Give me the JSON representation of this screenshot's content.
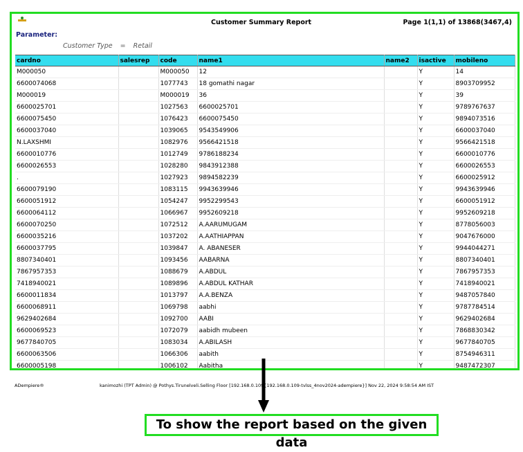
{
  "report": {
    "title": "Customer Summary Report",
    "page_info": "Page 1(1,1) of 13868(3467,4)",
    "parameter_label": "Parameter:",
    "param_name": "Customer Type",
    "param_op": "=",
    "param_value": "Retail"
  },
  "table": {
    "columns": [
      "cardno",
      "salesrep",
      "code",
      "name1",
      "name2",
      "isactive",
      "mobileno"
    ],
    "rows": [
      [
        "M000050",
        "",
        "M000050",
        "12",
        "",
        "Y",
        "14"
      ],
      [
        "6600074068",
        "",
        "1077743",
        "18 gomathi nagar",
        "",
        "Y",
        "8903709952"
      ],
      [
        "M000019",
        "",
        "M000019",
        "36",
        "",
        "Y",
        "39"
      ],
      [
        "6600025701",
        "",
        "1027563",
        "6600025701",
        "",
        "Y",
        "9789767637"
      ],
      [
        "6600075450",
        "",
        "1076423",
        "6600075450",
        "",
        "Y",
        "9894073516"
      ],
      [
        "6600037040",
        "",
        "1039065",
        "9543549906",
        "",
        "Y",
        "6600037040"
      ],
      [
        "N.LAXSHMI",
        "",
        "1082976",
        "9566421518",
        "",
        "Y",
        "9566421518"
      ],
      [
        "6600010776",
        "",
        "1012749",
        "9786188234",
        "",
        "Y",
        "6600010776"
      ],
      [
        "6600026553",
        "",
        "1028280",
        "9843912388",
        "",
        "Y",
        "6600026553"
      ],
      [
        ".",
        "",
        "1027923",
        "9894582239",
        "",
        "Y",
        "6600025912"
      ],
      [
        "6600079190",
        "",
        "1083115",
        "9943639946",
        "",
        "Y",
        "9943639946"
      ],
      [
        "6600051912",
        "",
        "1054247",
        "9952299543",
        "",
        "Y",
        "6600051912"
      ],
      [
        "6600064112",
        "",
        "1066967",
        "9952609218",
        "",
        "Y",
        "9952609218"
      ],
      [
        "6600070250",
        "",
        "1072512",
        "A.AARUMUGAM",
        "",
        "Y",
        "8778056003"
      ],
      [
        "6600035216",
        "",
        "1037202",
        "A.AATHIAPPAN",
        "",
        "Y",
        "9047676000"
      ],
      [
        "6600037795",
        "",
        "1039847",
        "A. ABANESER",
        "",
        "Y",
        "9944044271"
      ],
      [
        "8807340401",
        "",
        "1093456",
        "AABARNA",
        "",
        "Y",
        "8807340401"
      ],
      [
        "7867957353",
        "",
        "1088679",
        "A.ABDUL",
        "",
        "Y",
        "7867957353"
      ],
      [
        "7418940021",
        "",
        "1089896",
        "A.ABDUL KATHAR",
        "",
        "Y",
        "7418940021"
      ],
      [
        "6600011834",
        "",
        "1013797",
        "A.A.BENZA",
        "",
        "Y",
        "9487057840"
      ],
      [
        "6600068911",
        "",
        "1069798",
        "aabhi",
        "",
        "Y",
        "9787784514"
      ],
      [
        "9629402684",
        "",
        "1092700",
        "AABI",
        "",
        "Y",
        "9629402684"
      ],
      [
        "6600069523",
        "",
        "1072079",
        "aabidh mubeen",
        "",
        "Y",
        "7868830342"
      ],
      [
        "9677840705",
        "",
        "1083034",
        "A.ABILASH",
        "",
        "Y",
        "9677840705"
      ],
      [
        "6600063506",
        "",
        "1066306",
        "aabith",
        "",
        "Y",
        "8754946311"
      ],
      [
        "6600005198",
        "",
        "1006102",
        "Aabitha",
        "",
        "Y",
        "9487472307"
      ]
    ]
  },
  "footer": {
    "app": "ADempiere®",
    "session": "kanimozhi (TPT Admin) @ Pothys.Tirunelveli.Selling Floor [192.168.0.109{192.168.0.109-tvlss_4nov2024-adempiere}] Nov 22, 2024 9:58:54 AM IST"
  },
  "annotation": {
    "caption": "To show the report based on the given data",
    "highlight_color": "#22dd22"
  }
}
